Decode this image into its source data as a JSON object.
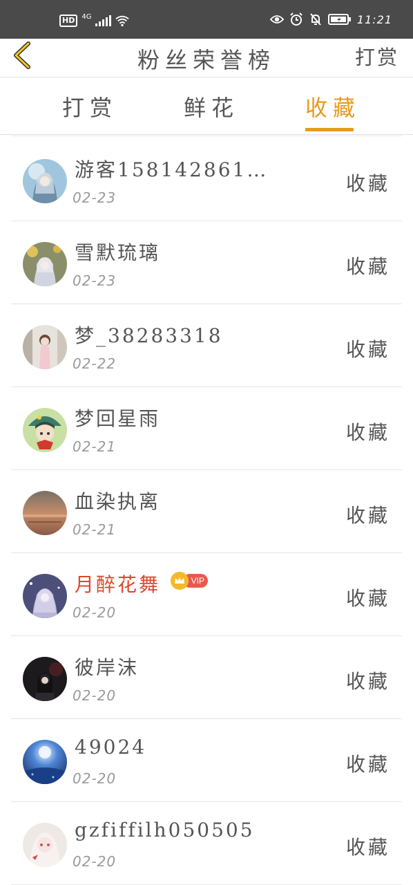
{
  "status_bar": {
    "hd": "HD",
    "network": "4G",
    "time": "11:21"
  },
  "header": {
    "title": "粉丝荣誉榜",
    "action_label": "打赏"
  },
  "tabs": [
    {
      "label": "打赏",
      "active": false
    },
    {
      "label": "鲜花",
      "active": false
    },
    {
      "label": "收藏",
      "active": true
    }
  ],
  "colors": {
    "accent": "#e89a1c",
    "vip_name": "#e0462c",
    "status_bar_bg": "#4a4a4a"
  },
  "fans": [
    {
      "name": "游客158142861…",
      "date": "02-23",
      "action": "收藏"
    },
    {
      "name": "雪默琉璃",
      "date": "02-23",
      "action": "收藏"
    },
    {
      "name": "梦_38283318",
      "date": "02-22",
      "action": "收藏"
    },
    {
      "name": "梦回星雨",
      "date": "02-21",
      "action": "收藏"
    },
    {
      "name": "血染执离",
      "date": "02-21",
      "action": "收藏"
    },
    {
      "name": "月醉花舞",
      "date": "02-20",
      "action": "收藏",
      "vip": true,
      "vip_label": "VIP"
    },
    {
      "name": "彼岸沫",
      "date": "02-20",
      "action": "收藏"
    },
    {
      "name": "49024",
      "date": "02-20",
      "action": "收藏"
    },
    {
      "name": "gzfiffilh050505",
      "date": "02-20",
      "action": "收藏"
    }
  ]
}
